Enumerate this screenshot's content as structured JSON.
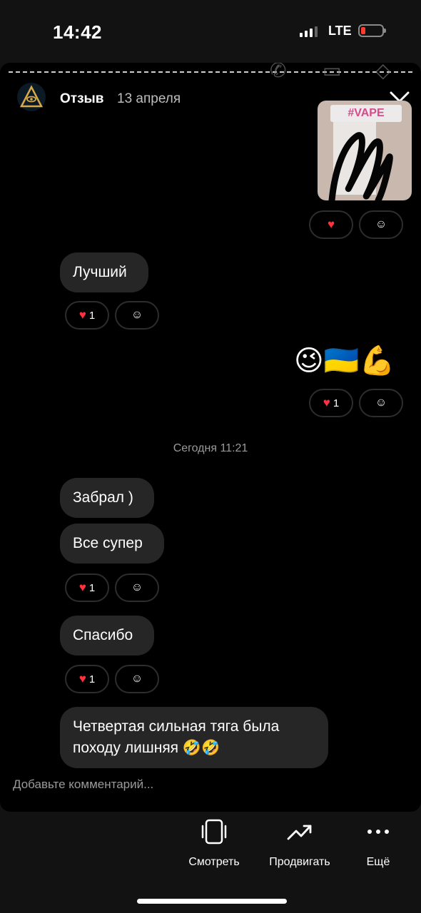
{
  "status": {
    "time": "14:42",
    "network": "LTE"
  },
  "story": {
    "username": "Отзыв",
    "date": "13 апреля",
    "thumbnail_label": "#VAPE"
  },
  "messages": [
    {
      "text": "Лучший",
      "like_count": "1"
    },
    {
      "text": "😉🇺🇦💪",
      "like_count": "1"
    },
    {
      "text": "Забрал )"
    },
    {
      "text": "Все супер",
      "like_count": "1"
    },
    {
      "text": "Спасибо",
      "like_count": "1"
    },
    {
      "text": "Четвертая сильная тяга была походу лишняя 🤣🤣"
    }
  ],
  "timestamp": "Сегодня 11:21",
  "comment_placeholder": "Добавьте комментарий...",
  "actions": [
    {
      "label": "Смотреть",
      "icon": "view-icon"
    },
    {
      "label": "Продвигать",
      "icon": "trend-up-icon"
    },
    {
      "label": "Ещё",
      "icon": "more-dots-icon"
    }
  ],
  "colors": {
    "heart": "#ff3040",
    "bubble": "#262626",
    "battery_low": "#ff3b30"
  }
}
